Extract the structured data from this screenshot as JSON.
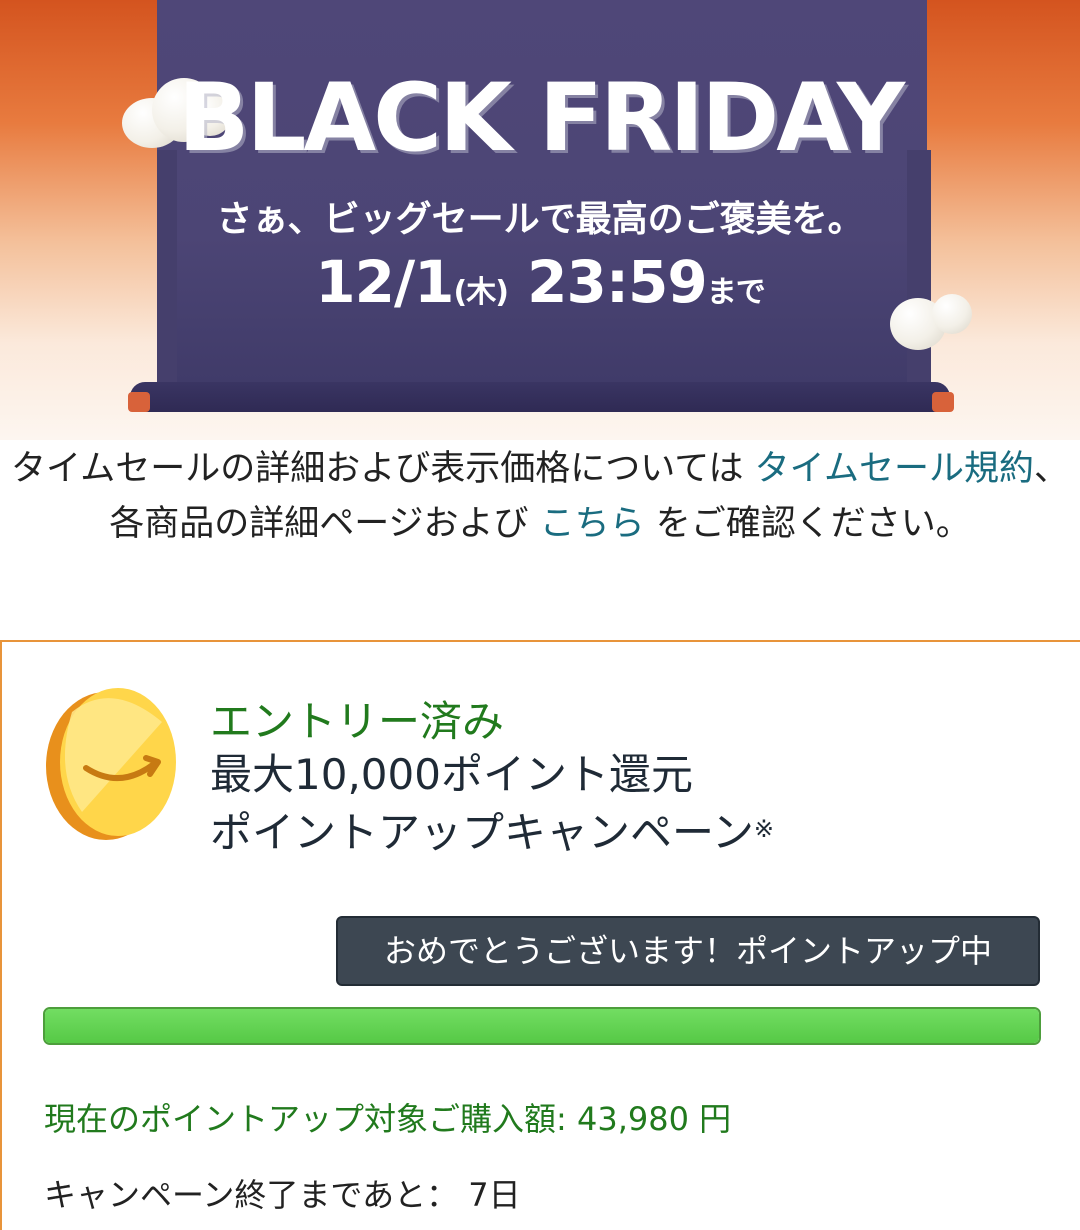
{
  "banner": {
    "title": "BLACK FRIDAY",
    "subtitle": "さぁ、ビッグセールで最高のご褒美を。",
    "date_main": "12/1",
    "date_weekday": "(木)",
    "date_time": "23:59",
    "date_suffix": "まで",
    "colors": {
      "background_top": "#d4541f",
      "scroll": "#4c4575"
    }
  },
  "notice": {
    "text_1": "タイムセールの詳細および表示価格については ",
    "link_1": "タイムセール規約",
    "text_2": "、各商品の詳細ページおよび ",
    "link_2": "こちら",
    "text_3": " をご確認ください。"
  },
  "campaign": {
    "icon": "amazon-coin-icon",
    "entry_status": "エントリー済み",
    "title_line1": "最大10,000ポイント還元",
    "title_line2": "ポイントアップキャンペーン",
    "title_mark": "※",
    "status_button": "おめでとうございます！ポイントアップ中",
    "progress_fraction": 1.0,
    "purchase_label": "現在のポイントアップ対象ご購入額: ",
    "purchase_amount": "43,980 円",
    "remaining_label": "キャンペーン終了まであと： ",
    "remaining_value": "7日",
    "colors": {
      "accent_green": "#217a1d",
      "progress": "#5fd14e",
      "border": "#e8943a",
      "button": "#3d4752"
    }
  }
}
